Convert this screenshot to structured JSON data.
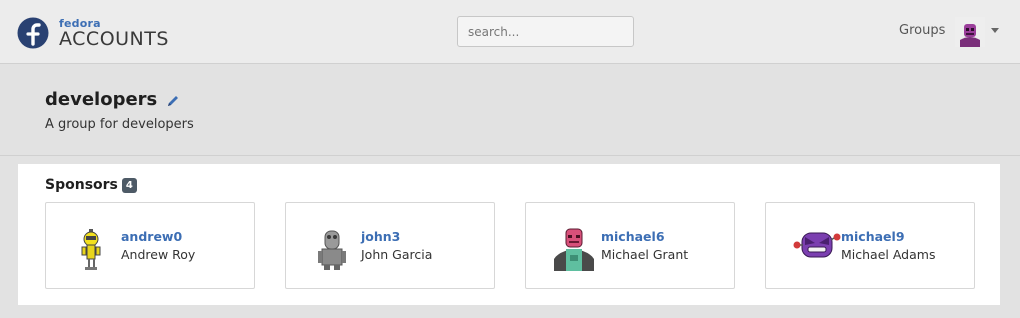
{
  "header": {
    "logo_small": "fedora",
    "logo_big": "ACCOUNTS",
    "search_placeholder": "search...",
    "nav_groups": "Groups",
    "user_menu_icon": "user-avatar",
    "caret_icon": "caret-down-icon"
  },
  "group": {
    "name": "developers",
    "description": "A group for developers",
    "edit_icon": "pencil-icon"
  },
  "sponsors": {
    "title": "Sponsors",
    "count": "4",
    "members": [
      {
        "username": "andrew0",
        "fullname": "Andrew Roy",
        "avatar": "yellow-robot-avatar"
      },
      {
        "username": "john3",
        "fullname": "John Garcia",
        "avatar": "gray-robot-avatar"
      },
      {
        "username": "michael6",
        "fullname": "Michael Grant",
        "avatar": "pink-robot-avatar"
      },
      {
        "username": "michael9",
        "fullname": "Michael Adams",
        "avatar": "purple-robot-avatar"
      }
    ]
  },
  "colors": {
    "link": "#3c6eb4",
    "badge": "#4d5a66",
    "fedora_blue": "#294172"
  }
}
